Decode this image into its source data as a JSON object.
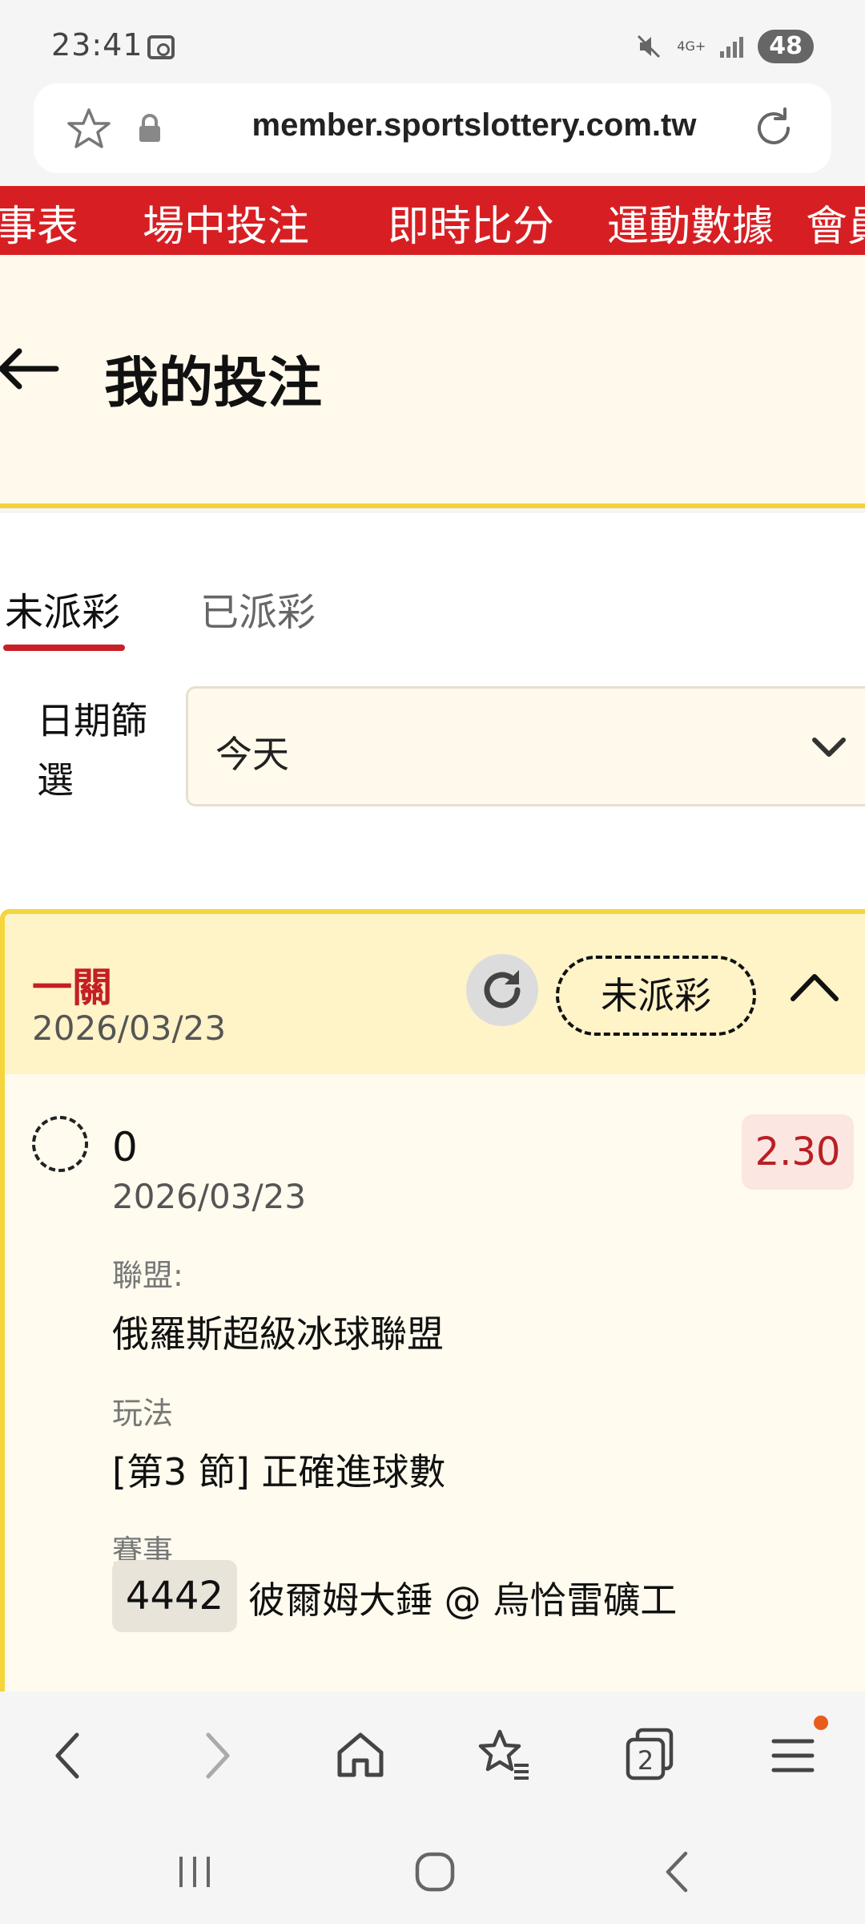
{
  "status_bar": {
    "time": "23:41",
    "network": "4G+",
    "battery": "48",
    "icons": [
      "screenshot-icon",
      "mute-icon",
      "signal-icon"
    ]
  },
  "browser": {
    "url": "member.sportslottery.com.tw",
    "tab_count": "2",
    "icons": [
      "star-icon",
      "lock-icon",
      "reload-icon",
      "back-icon",
      "forward-icon",
      "home-icon",
      "bookmarks-icon",
      "tabs-icon",
      "menu-icon"
    ]
  },
  "top_nav": {
    "items": [
      "事表",
      "場中投注",
      "即時比分",
      "運動數據",
      "會員"
    ]
  },
  "header": {
    "title": "我的投注"
  },
  "tabs": [
    {
      "label": "未派彩",
      "active": true
    },
    {
      "label": "已派彩",
      "active": false
    }
  ],
  "filter": {
    "label": "日期篩選",
    "value": "今天"
  },
  "bet": {
    "type": "一關",
    "date": "2026/03/23",
    "status": "未派彩",
    "selection": {
      "name": "0",
      "date": "2026/03/23",
      "odds": "2.30",
      "league_label": "聯盟:",
      "league": "俄羅斯超級冰球聯盟",
      "market_label": "玩法",
      "market": "[第3 節] 正確進球數",
      "event_label": "賽事",
      "event_code": "4442",
      "event_name": "彼爾姆大錘 @ 烏恰雷礦工"
    }
  },
  "colors": {
    "nav_red": "#d71f23",
    "accent_yellow": "#f6d43c",
    "odds_red": "#b91f24"
  }
}
